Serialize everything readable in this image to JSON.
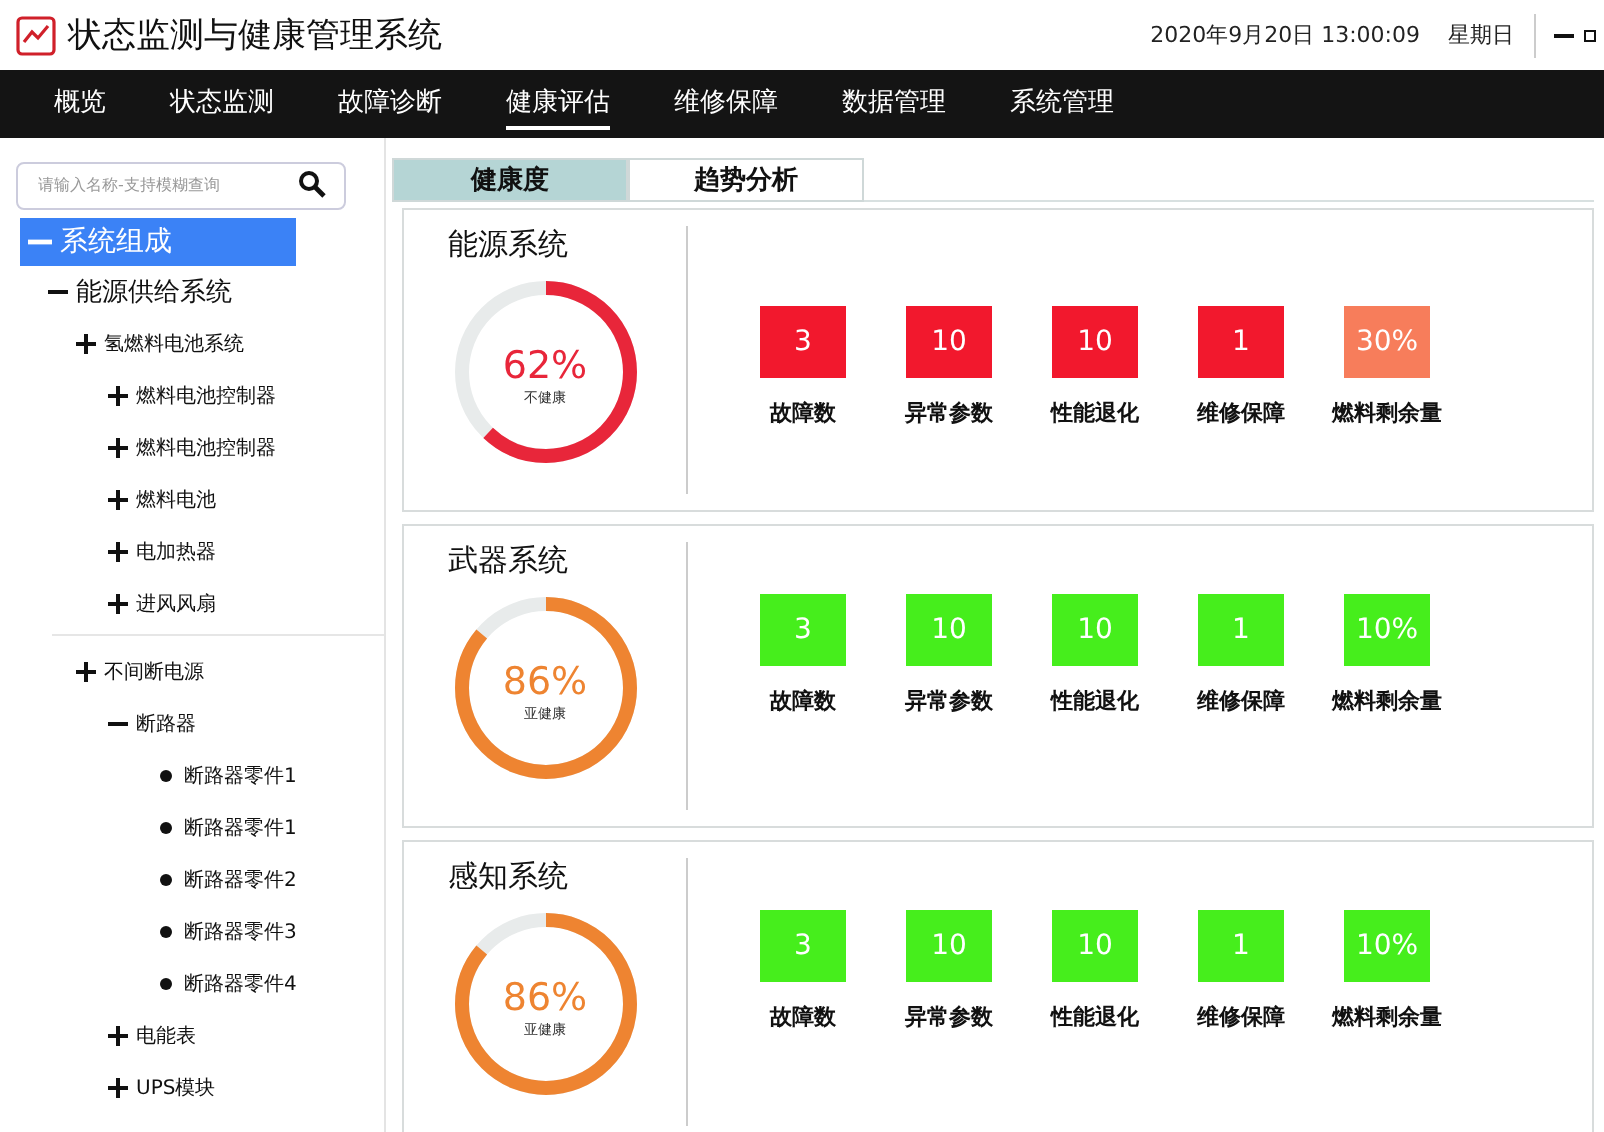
{
  "app": {
    "title": "状态监测与健康管理系统",
    "datetime": "2020年9月20日 13:00:09",
    "weekday": "星期日"
  },
  "nav": [
    {
      "label": "概览",
      "selected": false
    },
    {
      "label": "状态监测",
      "selected": false
    },
    {
      "label": "故障诊断",
      "selected": false
    },
    {
      "label": "健康评估",
      "selected": true
    },
    {
      "label": "维修保障",
      "selected": false
    },
    {
      "label": "数据管理",
      "selected": false
    },
    {
      "label": "系统管理",
      "selected": false
    }
  ],
  "search": {
    "placeholder": "请输入名称-支持模糊查询"
  },
  "tree": [
    {
      "label": "系统组成",
      "kind": "branch",
      "expanded": true,
      "selected": true,
      "children": [
        {
          "label": "能源供给系统",
          "kind": "branch",
          "expanded": true,
          "selected": false,
          "children": [
            {
              "label": "氢燃料电池系统",
              "kind": "branch",
              "expanded": false,
              "selected": false,
              "children": [
                {
                  "label": "燃料电池控制器",
                  "kind": "branch",
                  "expanded": false,
                  "selected": false
                },
                {
                  "label": "燃料电池控制器",
                  "kind": "branch",
                  "expanded": false,
                  "selected": false
                },
                {
                  "label": "燃料电池",
                  "kind": "branch",
                  "expanded": false,
                  "selected": false
                },
                {
                  "label": "电加热器",
                  "kind": "branch",
                  "expanded": false,
                  "selected": false
                },
                {
                  "label": "进风风扇",
                  "kind": "branch",
                  "expanded": false,
                  "selected": false
                }
              ]
            },
            {
              "label": "不间断电源",
              "kind": "branch",
              "expanded": false,
              "selected": false,
              "children": [
                {
                  "label": "断路器",
                  "kind": "branch",
                  "expanded": true,
                  "selected": false,
                  "children": [
                    {
                      "label": "断路器零件1",
                      "kind": "leaf",
                      "selected": false
                    },
                    {
                      "label": "断路器零件1",
                      "kind": "leaf",
                      "selected": false
                    },
                    {
                      "label": "断路器零件2",
                      "kind": "leaf",
                      "selected": false
                    },
                    {
                      "label": "断路器零件3",
                      "kind": "leaf",
                      "selected": false
                    },
                    {
                      "label": "断路器零件4",
                      "kind": "leaf",
                      "selected": false
                    }
                  ]
                },
                {
                  "label": "电能表",
                  "kind": "branch",
                  "expanded": false,
                  "selected": false
                },
                {
                  "label": "UPS模块",
                  "kind": "branch",
                  "expanded": false,
                  "selected": false
                }
              ]
            }
          ]
        }
      ]
    }
  ],
  "tabs": [
    {
      "label": "健康度",
      "selected": true
    },
    {
      "label": "趋势分析",
      "selected": false
    }
  ],
  "systems": [
    {
      "name": "能源系统",
      "level": 0.62,
      "percent": "62%",
      "status": "不健康",
      "color": "#e8263a",
      "metrics": [
        {
          "value": "3",
          "label": "故障数",
          "color": "#f2182d"
        },
        {
          "value": "10",
          "label": "异常参数",
          "color": "#f2182d"
        },
        {
          "value": "10",
          "label": "性能退化",
          "color": "#f2182d"
        },
        {
          "value": "1",
          "label": "维修保障",
          "color": "#f2182d"
        },
        {
          "value": "30%",
          "label": "燃料剩余量",
          "color": "#f77d5b"
        }
      ]
    },
    {
      "name": "武器系统",
      "level": 0.86,
      "percent": "86%",
      "status": "亚健康",
      "color": "#ee8431",
      "metrics": [
        {
          "value": "3",
          "label": "故障数",
          "color": "#46ee1c"
        },
        {
          "value": "10",
          "label": "异常参数",
          "color": "#46ee1c"
        },
        {
          "value": "10",
          "label": "性能退化",
          "color": "#46ee1c"
        },
        {
          "value": "1",
          "label": "维修保障",
          "color": "#46ee1c"
        },
        {
          "value": "10%",
          "label": "燃料剩余量",
          "color": "#46ee1c"
        }
      ]
    },
    {
      "name": "感知系统",
      "level": 0.86,
      "percent": "86%",
      "status": "亚健康",
      "color": "#ee8431",
      "metrics": [
        {
          "value": "3",
          "label": "故障数",
          "color": "#46ee1c"
        },
        {
          "value": "10",
          "label": "异常参数",
          "color": "#46ee1c"
        },
        {
          "value": "10",
          "label": "性能退化",
          "color": "#46ee1c"
        },
        {
          "value": "1",
          "label": "维修保障",
          "color": "#46ee1c"
        },
        {
          "value": "10%",
          "label": "燃料剩余量",
          "color": "#46ee1c"
        }
      ]
    }
  ]
}
